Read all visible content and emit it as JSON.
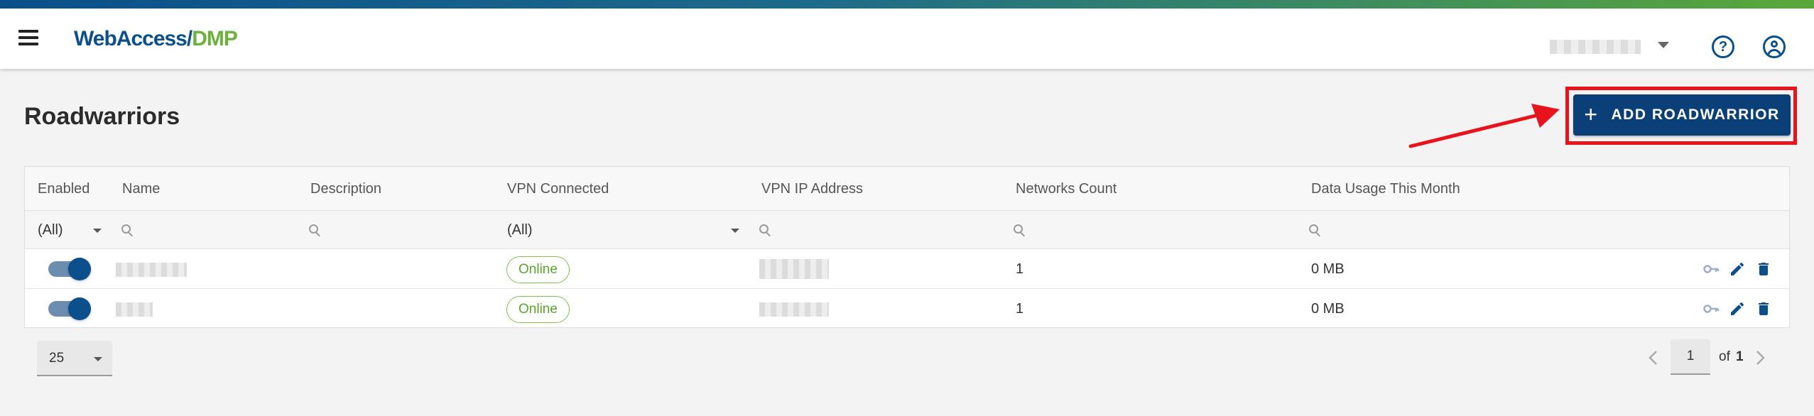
{
  "header": {
    "logo_part1": "WebAccess/",
    "logo_part2": "DMP",
    "colors": {
      "brand_blue": "#0b4f8c",
      "brand_green": "#6bb23a"
    }
  },
  "page": {
    "title": "Roadwarriors",
    "add_button_label": "ADD ROADWARRIOR",
    "add_button_icon": "plus-icon"
  },
  "table": {
    "columns": [
      "Enabled",
      "Name",
      "Description",
      "VPN Connected",
      "VPN IP Address",
      "Networks Count",
      "Data Usage This Month"
    ],
    "filters": {
      "enabled": "(All)",
      "vpn_connected": "(All)"
    },
    "rows": [
      {
        "enabled": true,
        "name": "",
        "description": "",
        "vpn_connected": "Online",
        "vpn_ip": "",
        "networks_count": "1",
        "data_usage": "0 MB"
      },
      {
        "enabled": true,
        "name": "",
        "description": "",
        "vpn_connected": "Online",
        "vpn_ip": "",
        "networks_count": "1",
        "data_usage": "0 MB"
      }
    ],
    "row_actions": [
      "key-icon",
      "edit-icon",
      "delete-icon"
    ]
  },
  "pagination": {
    "page_size": "25",
    "current_page": "1",
    "of_label": "of",
    "total_pages": "1"
  }
}
